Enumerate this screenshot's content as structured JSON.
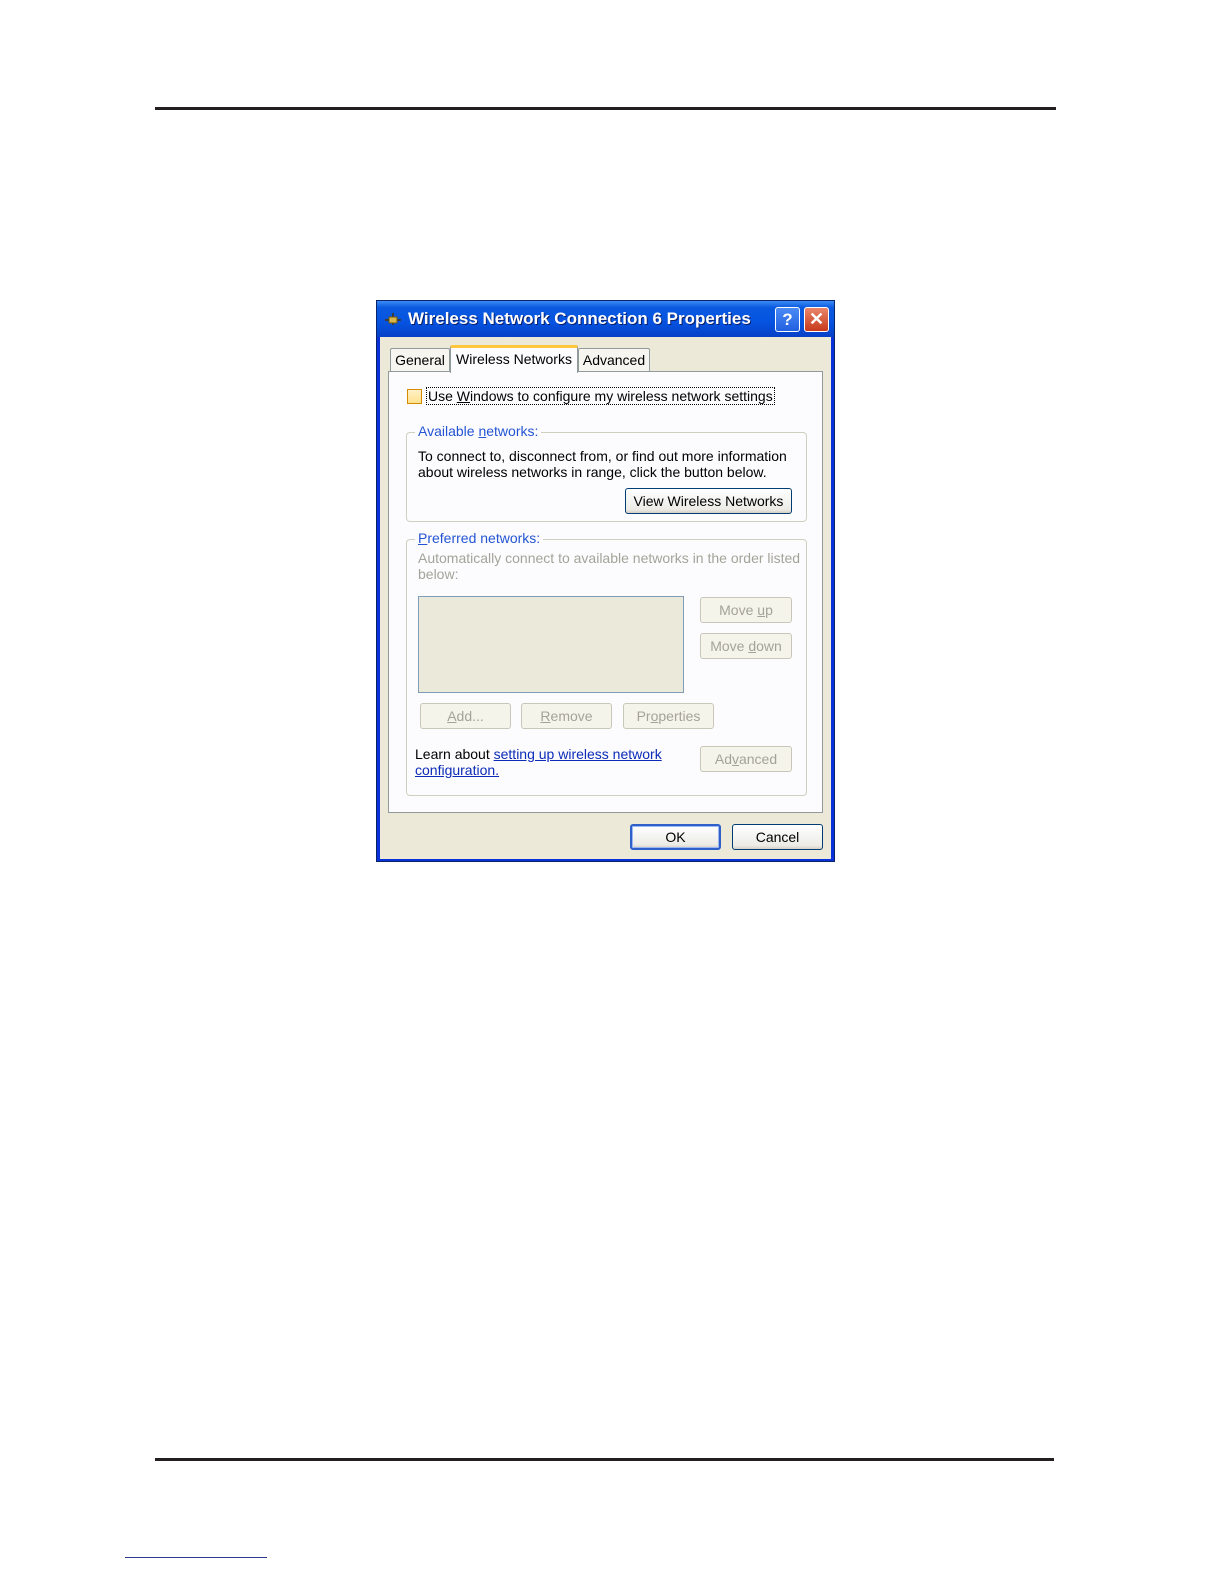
{
  "dialog": {
    "title": "Wireless Network Connection 6 Properties",
    "help_button": "?",
    "close_button": "✕",
    "icon": "network-connection-icon"
  },
  "tabs": [
    {
      "label": "General",
      "active": false
    },
    {
      "label": "Wireless Networks",
      "active": true
    },
    {
      "label": "Advanced",
      "active": false
    }
  ],
  "use_windows": {
    "checked": false,
    "pre": "Use ",
    "mnemonic": "W",
    "post": "indows to configure my wireless network settings"
  },
  "available": {
    "legend_pre": "Available ",
    "legend_mnemonic": "n",
    "legend_post": "etworks:",
    "line1": "To connect to, disconnect from, or find out more information",
    "line2": "about wireless networks in range, click the button below.",
    "view_button": "View Wireless Networks"
  },
  "preferred": {
    "legend_mnemonic": "P",
    "legend_post": "referred networks:",
    "line1": "Automatically connect to available networks in the order listed",
    "line2": "below:",
    "move_up_pre": "Move ",
    "move_up_mnemonic": "u",
    "move_up_post": "p",
    "move_down_pre": "Move ",
    "move_down_mnemonic": "d",
    "move_down_post": "own",
    "add_mnemonic": "A",
    "add_post": "dd...",
    "remove_mnemonic": "R",
    "remove_post": "emove",
    "properties_pre": "Pr",
    "properties_mnemonic": "o",
    "properties_post": "perties",
    "learn_text": "Learn about ",
    "learn_link_line1": "setting up wireless network",
    "learn_link_line2": "configuration.",
    "advanced_pre": "Ad",
    "advanced_mnemonic": "v",
    "advanced_post": "anced"
  },
  "footer": {
    "ok": "OK",
    "cancel": "Cancel"
  }
}
